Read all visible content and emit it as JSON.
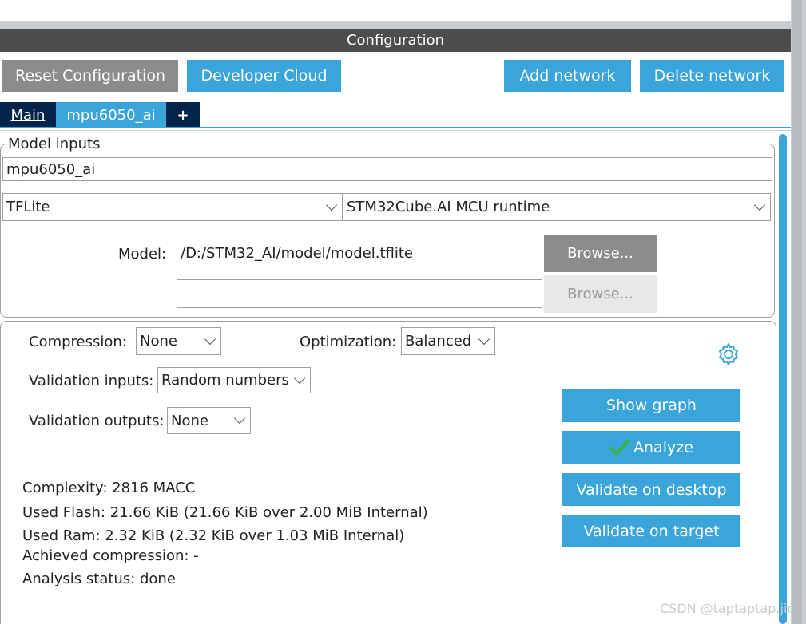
{
  "header": {
    "title": "Configuration"
  },
  "toolbar": {
    "reset": "Reset Configuration",
    "developer_cloud": "Developer Cloud",
    "add_network": "Add network",
    "delete_network": "Delete network"
  },
  "tabs": {
    "main": "Main",
    "model": "mpu6050_ai",
    "add": "+"
  },
  "model_inputs": {
    "legend": "Model inputs",
    "name_value": "mpu6050_ai",
    "framework": "TFLite",
    "runtime": "STM32Cube.AI MCU runtime",
    "model_label": "Model:",
    "model_path": "/D:/STM32_AI/model/model.tflite",
    "second_path": "",
    "browse1": "Browse...",
    "browse2": "Browse..."
  },
  "settings": {
    "compression_label": "Compression:",
    "compression_value": "None",
    "optimization_label": "Optimization:",
    "optimization_value": "Balanced",
    "validation_inputs_label": "Validation inputs:",
    "validation_inputs_value": "Random numbers",
    "validation_outputs_label": "Validation outputs:",
    "validation_outputs_value": "None"
  },
  "actions": {
    "show_graph": "Show graph",
    "analyze": "Analyze",
    "validate_desktop": "Validate on desktop",
    "validate_target": "Validate on target"
  },
  "results": {
    "complexity": "Complexity:  2816 MACC",
    "used_flash": "Used Flash: 21.66 KiB (21.66 KiB over 2.00 MiB Internal)",
    "used_ram": "Used Ram: 2.32 KiB (2.32 KiB over 1.03 MiB Internal)",
    "achieved_compression": "Achieved compression: -",
    "analysis_status": "Analysis status: done"
  },
  "watermark": "CSDN @taptaptap.jic",
  "colors": {
    "accent": "#3aa5db",
    "navy": "#03234b",
    "header": "#4d4d4d",
    "check": "#3cb043"
  }
}
